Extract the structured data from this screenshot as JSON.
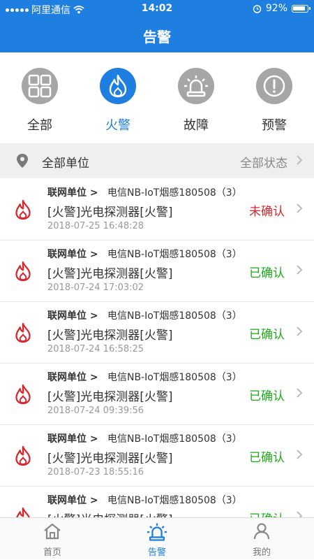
{
  "status_bar": {
    "carrier": "阿里通信",
    "time": "14:02",
    "battery": "92%",
    "battery_level": 0.92
  },
  "header": {
    "title": "告警"
  },
  "categories": [
    {
      "label": "全部",
      "icon": "grid-icon",
      "active": false
    },
    {
      "label": "火警",
      "icon": "flame-icon",
      "active": true
    },
    {
      "label": "故障",
      "icon": "alarm-light-icon",
      "active": false
    },
    {
      "label": "预警",
      "icon": "exclamation-icon",
      "active": false
    }
  ],
  "filter": {
    "unit_label": "全部单位",
    "state_label": "全部状态"
  },
  "alerts": [
    {
      "unit_prefix": "联网单位 >",
      "device": "电信NB-IoT烟感180508（3）",
      "title": "[火警]光电探测器[火警]",
      "time": "2018-07-25 16:48:28",
      "status": "未确认",
      "status_color": "#d9262b"
    },
    {
      "unit_prefix": "联网单位 >",
      "device": "电信NB-IoT烟感180508（3）",
      "title": "[火警]光电探测器[火警]",
      "time": "2018-07-24 17:03:02",
      "status": "已确认",
      "status_color": "#1aad19"
    },
    {
      "unit_prefix": "联网单位 >",
      "device": "电信NB-IoT烟感180508（3）",
      "title": "[火警]光电探测器[火警]",
      "time": "2018-07-24 16:58:25",
      "status": "已确认",
      "status_color": "#1aad19"
    },
    {
      "unit_prefix": "联网单位 >",
      "device": "电信NB-IoT烟感180508（3）",
      "title": "[火警]光电探测器[火警]",
      "time": "2018-07-24 09:39:56",
      "status": "已确认",
      "status_color": "#1aad19"
    },
    {
      "unit_prefix": "联网单位 >",
      "device": "电信NB-IoT烟感180508（3）",
      "title": "[火警]光电探测器[火警]",
      "time": "2018-07-23 18:55:16",
      "status": "已确认",
      "status_color": "#1aad19"
    },
    {
      "unit_prefix": "联网单位 >",
      "device": "电信NB-IoT烟感180508（3）",
      "title": "[火警]光电探测器[火警]",
      "time": "",
      "status": "已确认",
      "status_color": "#1aad19"
    }
  ],
  "tabbar": [
    {
      "label": "首页",
      "icon": "home-icon",
      "active": false
    },
    {
      "label": "告警",
      "icon": "alarm-light-icon",
      "active": true
    },
    {
      "label": "我的",
      "icon": "user-icon",
      "active": false
    }
  ],
  "colors": {
    "primary": "#1f7fe0",
    "fire_red": "#d9262b",
    "confirmed_green": "#1aad19",
    "inactive_gray": "#a6a6a6"
  }
}
